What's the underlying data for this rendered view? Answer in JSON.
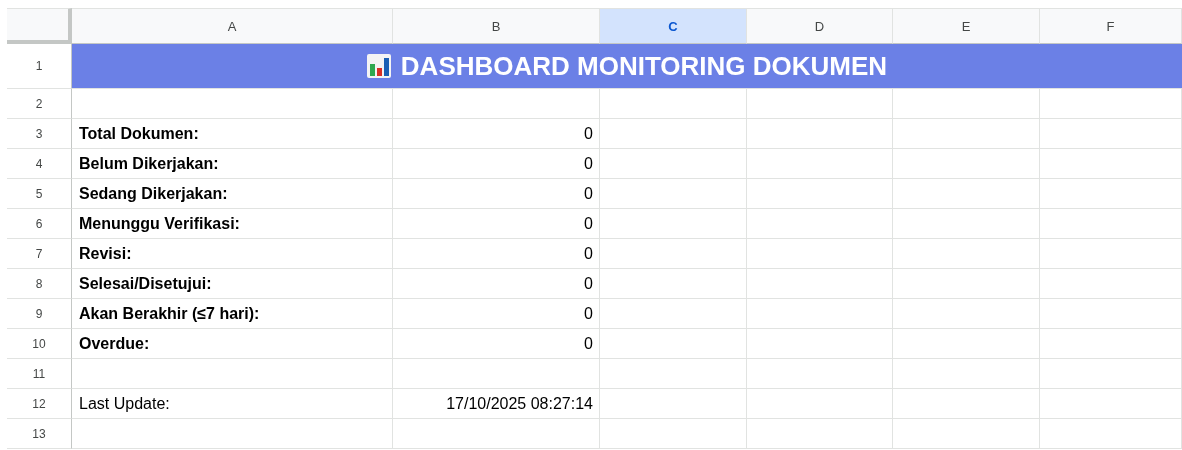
{
  "columns": [
    {
      "label": "A",
      "selected": false
    },
    {
      "label": "B",
      "selected": false
    },
    {
      "label": "C",
      "selected": true
    },
    {
      "label": "D",
      "selected": false
    },
    {
      "label": "E",
      "selected": false
    },
    {
      "label": "F",
      "selected": false
    }
  ],
  "rows": [
    {
      "number": "1",
      "kind": "title",
      "text": "DASHBOARD MONITORING DOKUMEN"
    },
    {
      "number": "2",
      "kind": "empty"
    },
    {
      "number": "3",
      "kind": "stat",
      "label": "Total Dokumen:",
      "value": "0",
      "bold": true
    },
    {
      "number": "4",
      "kind": "stat",
      "label": "Belum Dikerjakan:",
      "value": "0",
      "bold": true
    },
    {
      "number": "5",
      "kind": "stat",
      "label": "Sedang Dikerjakan:",
      "value": "0",
      "bold": true
    },
    {
      "number": "6",
      "kind": "stat",
      "label": "Menunggu Verifikasi:",
      "value": "0",
      "bold": true
    },
    {
      "number": "7",
      "kind": "stat",
      "label": "Revisi:",
      "value": "0",
      "bold": true
    },
    {
      "number": "8",
      "kind": "stat",
      "label": "Selesai/Disetujui:",
      "value": "0",
      "bold": true
    },
    {
      "number": "9",
      "kind": "stat",
      "label": "Akan Berakhir (≤7 hari):",
      "value": "0",
      "bold": true
    },
    {
      "number": "10",
      "kind": "stat",
      "label": "Overdue:",
      "value": "0",
      "bold": true
    },
    {
      "number": "11",
      "kind": "empty"
    },
    {
      "number": "12",
      "kind": "stat",
      "label": "Last Update:",
      "value": "17/10/2025 08:27:14",
      "bold": false
    },
    {
      "number": "13",
      "kind": "empty"
    }
  ]
}
